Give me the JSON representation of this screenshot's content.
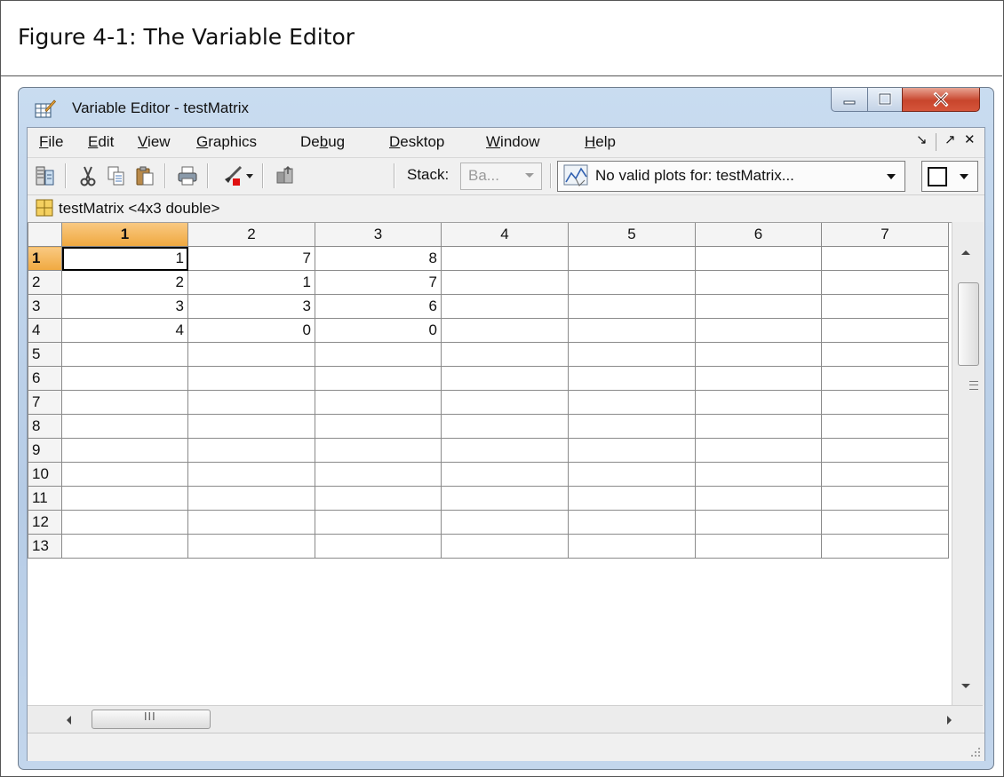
{
  "caption": "Figure 4-1: The Variable Editor",
  "window": {
    "title": "Variable Editor - testMatrix"
  },
  "menu": {
    "items": [
      {
        "label": "File",
        "mnemonic": "F",
        "rest": "ile"
      },
      {
        "label": "Edit",
        "mnemonic": "E",
        "rest": "dit"
      },
      {
        "label": "View",
        "mnemonic": "V",
        "rest": "iew"
      },
      {
        "label": "Graphics",
        "mnemonic": "G",
        "rest": "raphics"
      },
      {
        "label": "Debug",
        "pre": "De",
        "mnemonic": "b",
        "rest": "ug"
      },
      {
        "label": "Desktop",
        "mnemonic": "D",
        "rest": "esktop"
      },
      {
        "label": "Window",
        "mnemonic": "W",
        "rest": "indow"
      },
      {
        "label": "Help",
        "mnemonic": "H",
        "rest": "elp"
      }
    ],
    "undock_glyph": "↘",
    "dock_glyph": "↗",
    "close_glyph": "✕"
  },
  "toolbar": {
    "stack_label": "Stack:",
    "stack_value": "Ba...",
    "plot_value": "No valid plots for: testMatrix...",
    "icons": [
      "import-data-icon",
      "cut-icon",
      "copy-icon",
      "paste-icon",
      "print-icon",
      "brush-icon",
      "stack-up-icon",
      "plot-icon"
    ]
  },
  "variable": {
    "label": "testMatrix <4x3 double>"
  },
  "grid": {
    "columns": [
      "1",
      "2",
      "3",
      "4",
      "5",
      "6",
      "7"
    ],
    "rows": [
      {
        "label": "1",
        "cells": [
          "1",
          "7",
          "8",
          "",
          "",
          "",
          ""
        ]
      },
      {
        "label": "2",
        "cells": [
          "2",
          "1",
          "7",
          "",
          "",
          "",
          ""
        ]
      },
      {
        "label": "3",
        "cells": [
          "3",
          "3",
          "6",
          "",
          "",
          "",
          ""
        ]
      },
      {
        "label": "4",
        "cells": [
          "4",
          "0",
          "0",
          "",
          "",
          "",
          ""
        ]
      },
      {
        "label": "5",
        "cells": [
          "",
          "",
          "",
          "",
          "",
          "",
          ""
        ]
      },
      {
        "label": "6",
        "cells": [
          "",
          "",
          "",
          "",
          "",
          "",
          ""
        ]
      },
      {
        "label": "7",
        "cells": [
          "",
          "",
          "",
          "",
          "",
          "",
          ""
        ]
      },
      {
        "label": "8",
        "cells": [
          "",
          "",
          "",
          "",
          "",
          "",
          ""
        ]
      },
      {
        "label": "9",
        "cells": [
          "",
          "",
          "",
          "",
          "",
          "",
          ""
        ]
      },
      {
        "label": "10",
        "cells": [
          "",
          "",
          "",
          "",
          "",
          "",
          ""
        ]
      },
      {
        "label": "11",
        "cells": [
          "",
          "",
          "",
          "",
          "",
          "",
          ""
        ]
      },
      {
        "label": "12",
        "cells": [
          "",
          "",
          "",
          "",
          "",
          "",
          ""
        ]
      },
      {
        "label": "13",
        "cells": [
          "",
          "",
          "",
          "",
          "",
          "",
          ""
        ]
      }
    ]
  },
  "hscroll": {
    "grip": "III"
  },
  "colors": {
    "active_header": "#f0a940",
    "title_bar": "#c9dcf0",
    "close_button": "#c8452c"
  }
}
